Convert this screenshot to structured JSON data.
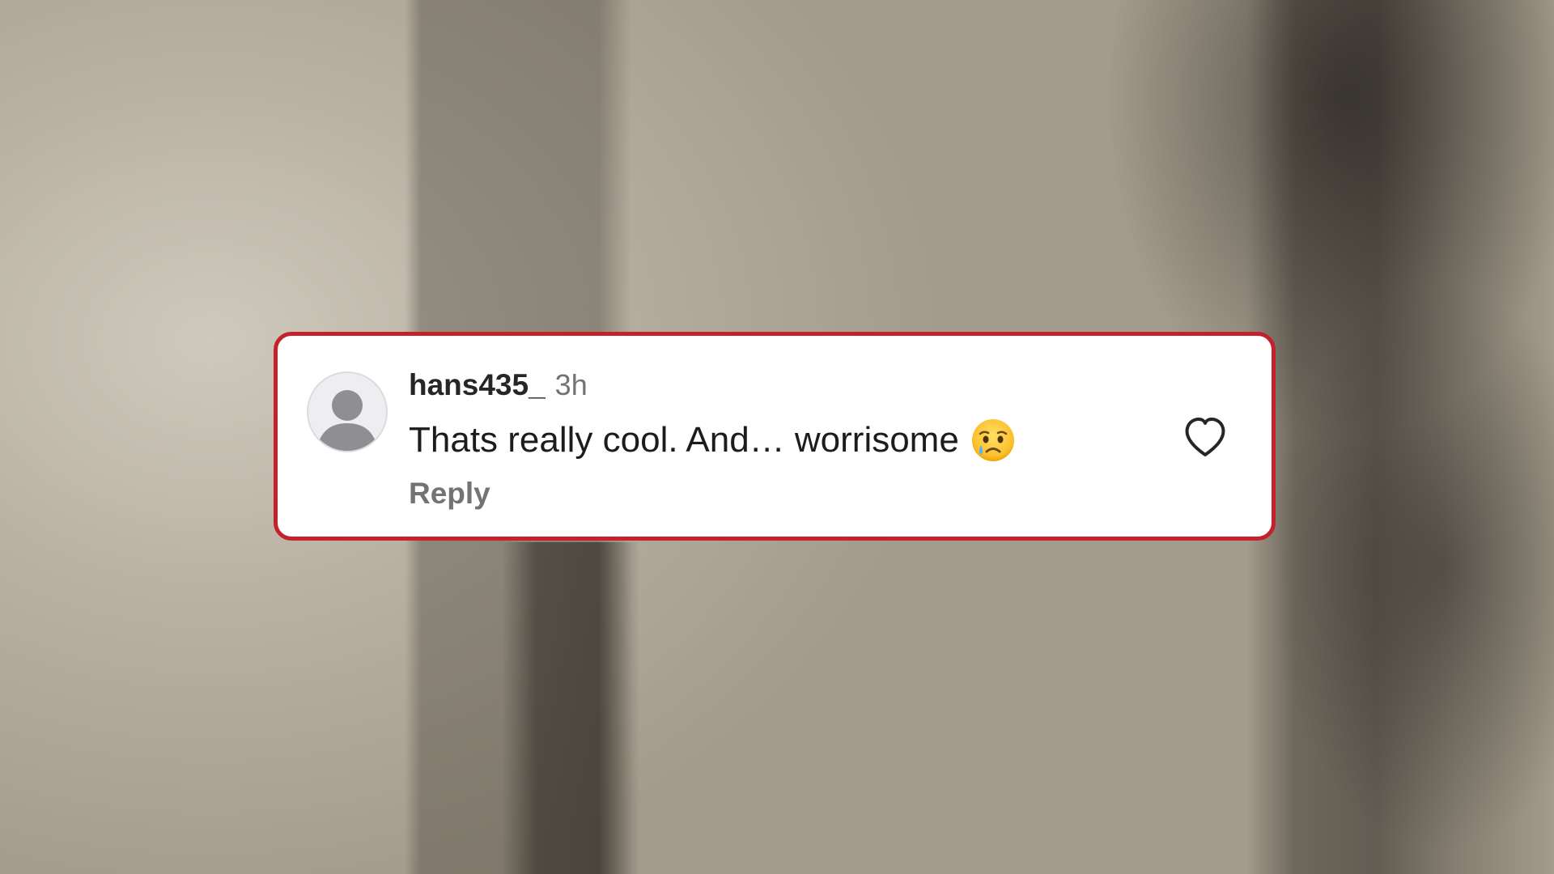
{
  "comment": {
    "username": "hans435_",
    "timestamp": "3h",
    "text": "Thats really cool. And… worrisome",
    "emoji": "crying-face",
    "reply_label": "Reply",
    "like_icon": "heart-outline-icon",
    "avatar_icon": "default-user-avatar-icon"
  },
  "colors": {
    "card_border": "#c4222a",
    "card_background": "#ffffff",
    "username": "#262626",
    "secondary_text": "#737373"
  }
}
